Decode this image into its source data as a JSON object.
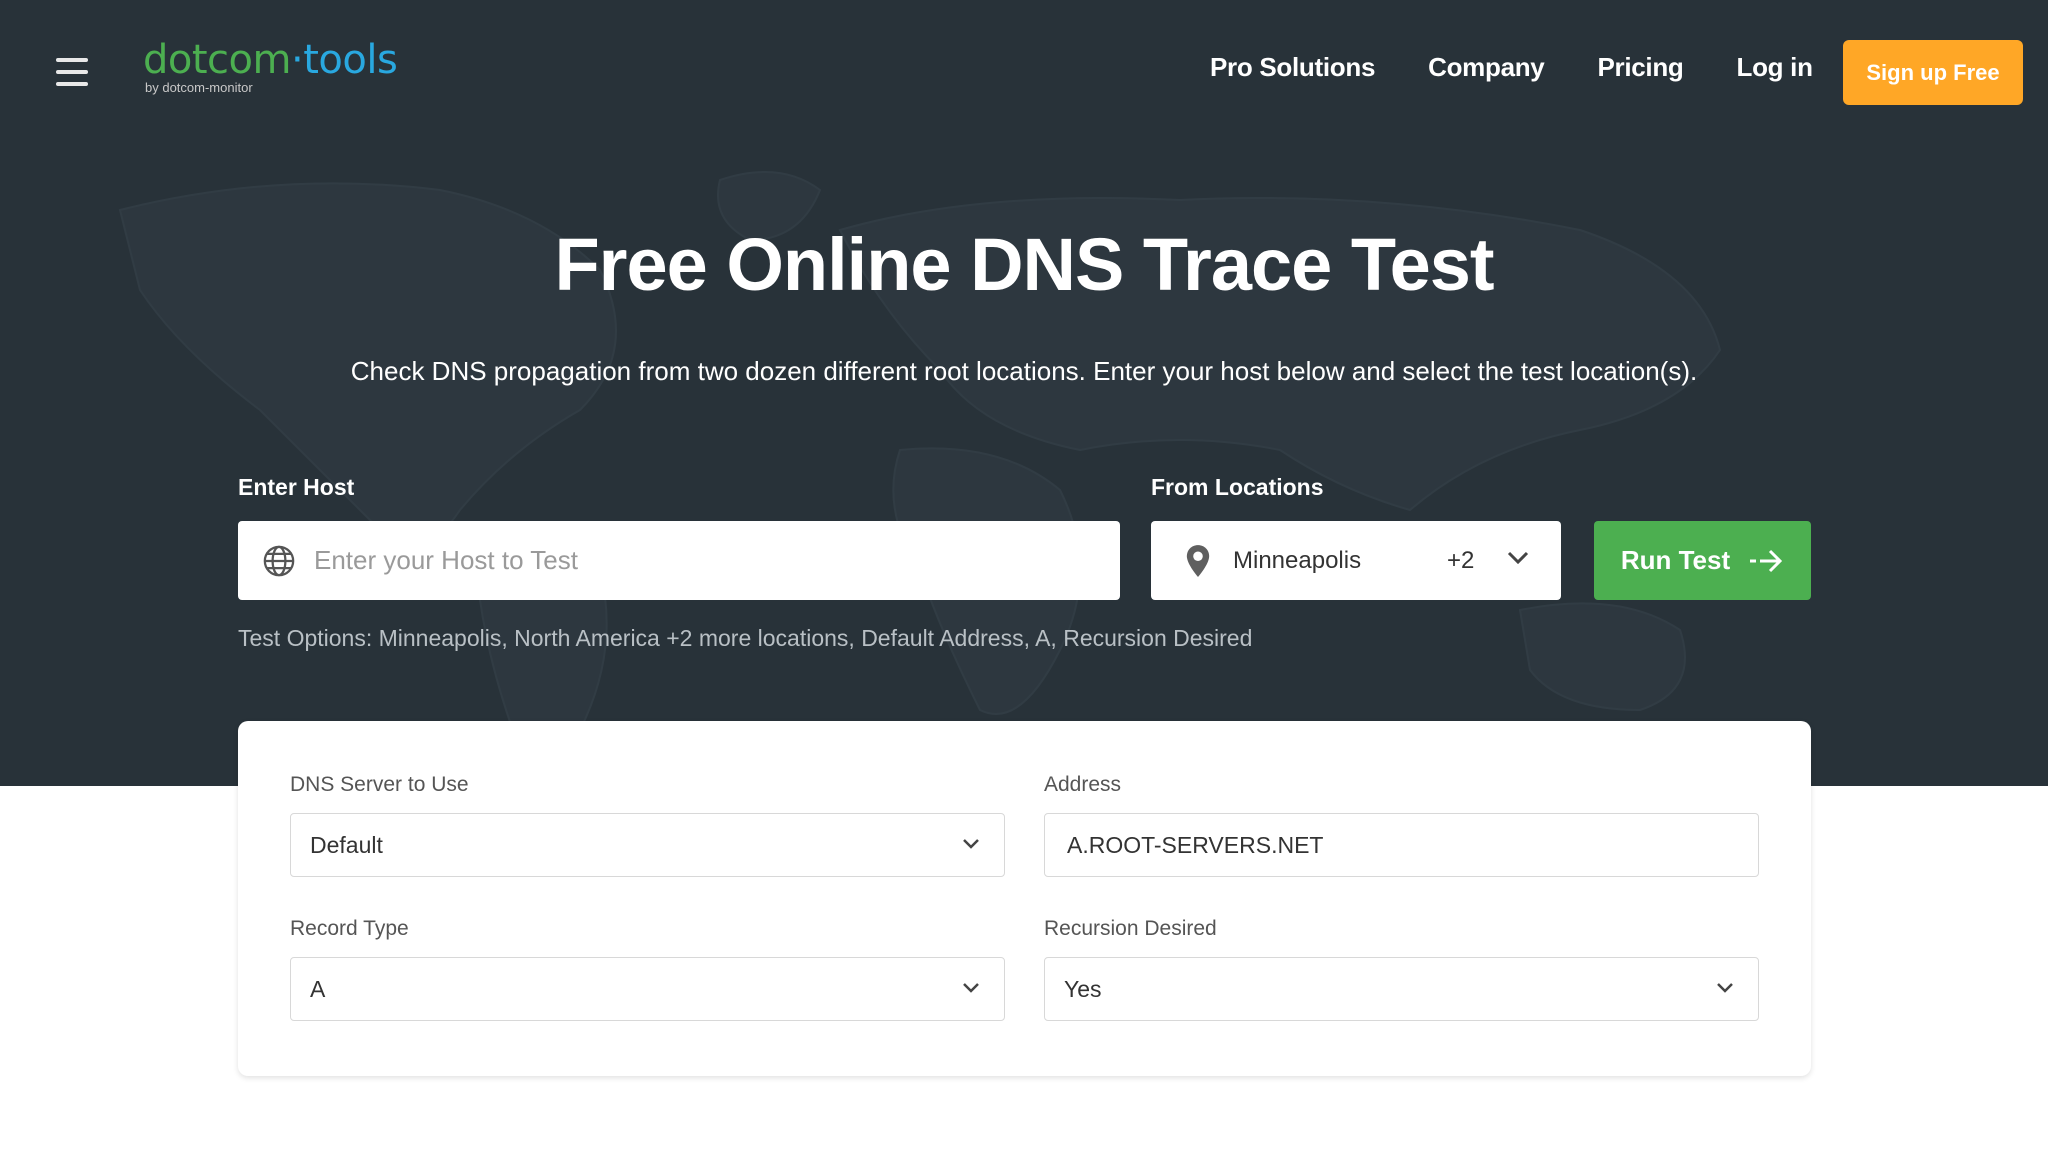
{
  "header": {
    "logo": {
      "part1": "dotcom",
      "part2": "·tools",
      "sub": "by dotcom-monitor"
    },
    "nav": [
      "Pro Solutions",
      "Company",
      "Pricing",
      "Log in"
    ],
    "signup_label": "Sign up Free"
  },
  "hero": {
    "title": "Free Online DNS Trace Test",
    "subtitle": "Check DNS propagation from two dozen different root locations. Enter your host below and select the test location(s)."
  },
  "form": {
    "host_label": "Enter Host",
    "host_placeholder": "Enter your Host to Test",
    "host_value": "",
    "locations_label": "From Locations",
    "location_selected": "Minneapolis",
    "location_extra": "+2",
    "run_label": "Run Test",
    "test_options": "Test Options: Minneapolis, North America +2 more locations, Default Address, A, Recursion Desired"
  },
  "settings": {
    "dns_server": {
      "label": "DNS Server to Use",
      "value": "Default"
    },
    "address": {
      "label": "Address",
      "value": "A.ROOT-SERVERS.NET"
    },
    "record_type": {
      "label": "Record Type",
      "value": "A"
    },
    "recursion": {
      "label": "Recursion Desired",
      "value": "Yes"
    }
  },
  "colors": {
    "dark_bg": "#283239",
    "accent_orange": "#ffa726",
    "accent_green": "#4caf50",
    "logo_blue": "#29a8e0"
  }
}
